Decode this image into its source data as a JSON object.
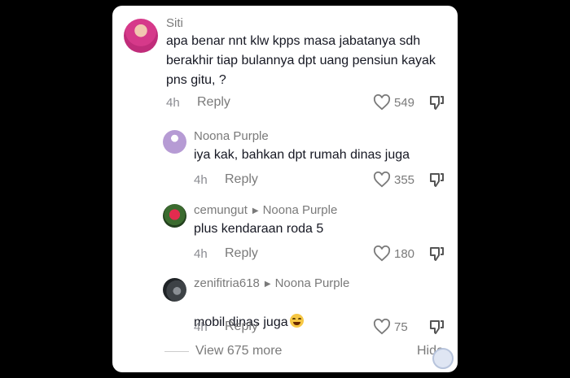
{
  "comments": [
    {
      "username": "Siti",
      "text": "apa benar nnt klw kpps masa jabatanya sdh\nberakhir tiap bulannya dpt uang pensiun kayak\npns gitu, ?",
      "time": "4h",
      "reply_label": "Reply",
      "likes": "549"
    },
    {
      "username": "Noona Purple",
      "text": "iya kak, bahkan dpt rumah dinas juga",
      "time": "4h",
      "reply_label": "Reply",
      "likes": "355"
    },
    {
      "username": "cemungut",
      "reply_to": "Noona Purple",
      "text": "plus kendaraan roda 5",
      "time": "4h",
      "reply_label": "Reply",
      "likes": "180"
    },
    {
      "username": "zenifitria618",
      "reply_to": "Noona Purple",
      "text": "mobil dinas juga",
      "emoji": "grinning-sweat-emoji",
      "time": "4h",
      "reply_label": "Reply",
      "likes": "75"
    }
  ],
  "footer": {
    "view_more": "View 675 more",
    "hide": "Hide"
  },
  "colors": {
    "text_primary": "#161823",
    "text_secondary": "#7a7a7a",
    "background": "#ffffff"
  }
}
